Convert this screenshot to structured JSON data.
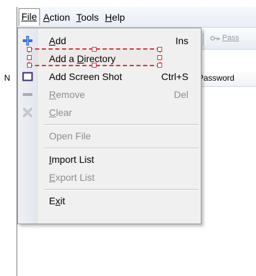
{
  "menubar": {
    "items": [
      {
        "label": "File",
        "underline_index": 0
      },
      {
        "label": "Action",
        "underline_index": 0
      },
      {
        "label": "Tools",
        "underline_index": 0
      },
      {
        "label": "Help",
        "underline_index": 0
      }
    ]
  },
  "toolbar": {
    "password_button_label": "Pass"
  },
  "list": {
    "col_first_label": "N",
    "col_password_label": "Password"
  },
  "file_menu": {
    "items": [
      {
        "label": "Add",
        "underline": "A",
        "shortcut": "Ins",
        "icon": "plus-icon",
        "enabled": true
      },
      {
        "label": "Add a Directory",
        "underline": "D",
        "shortcut": "",
        "icon": "",
        "enabled": true,
        "highlighted": true
      },
      {
        "label": "Add Screen Shot",
        "underline": "",
        "shortcut": "Ctrl+S",
        "icon": "screenshot-icon",
        "enabled": true
      },
      {
        "label": "Remove",
        "underline": "R",
        "shortcut": "Del",
        "icon": "minus-icon",
        "enabled": false
      },
      {
        "label": "Clear",
        "underline": "C",
        "shortcut": "",
        "icon": "clear-icon",
        "enabled": false
      },
      {
        "label": "Open File",
        "underline": "",
        "shortcut": "",
        "icon": "",
        "enabled": false
      },
      {
        "label": "Import List",
        "underline": "I",
        "shortcut": "",
        "icon": "",
        "enabled": true
      },
      {
        "label": "Export List",
        "underline": "E",
        "shortcut": "",
        "icon": "",
        "enabled": false
      },
      {
        "label": "Exit",
        "underline": "x",
        "shortcut": "",
        "icon": "",
        "enabled": true
      }
    ]
  },
  "colors": {
    "highlight_border": "#d4373f",
    "disabled_text": "#8e8e8e",
    "plus_icon": "#3a6fd8"
  }
}
